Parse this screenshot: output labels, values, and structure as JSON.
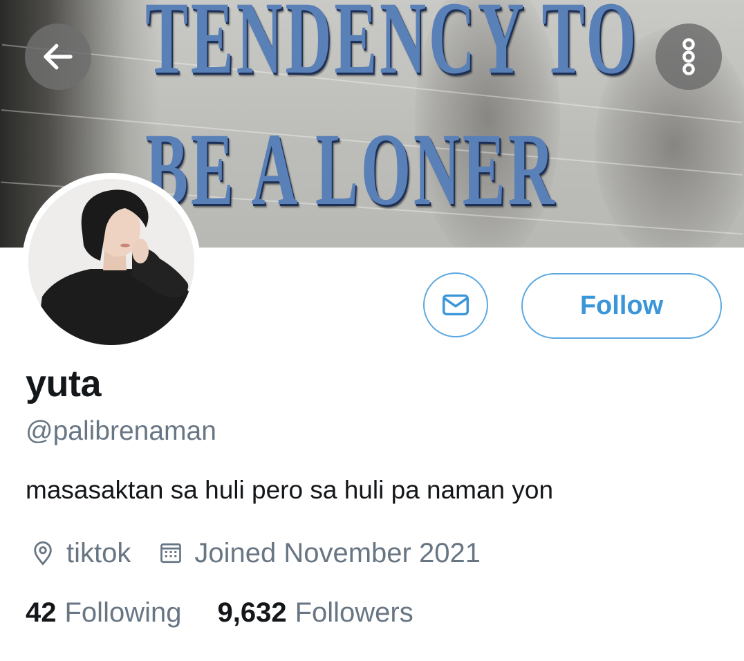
{
  "banner": {
    "line1": "TENDENCY TO",
    "line2": "BE A LONER"
  },
  "header": {
    "back_icon": "arrow-left-icon",
    "more_icon": "more-vertical-icon"
  },
  "actions": {
    "message_icon": "envelope-icon",
    "follow_label": "Follow",
    "accent_color": "#3b96d9"
  },
  "profile": {
    "name": "yuta",
    "handle": "@palibrenaman",
    "bio": "masasaktan sa huli pero sa huli pa naman yon",
    "location": "tiktok",
    "joined": "Joined November 2021"
  },
  "stats": {
    "following_count": "42",
    "following_label": "Following",
    "followers_count": "9,632",
    "followers_label": "Followers"
  }
}
